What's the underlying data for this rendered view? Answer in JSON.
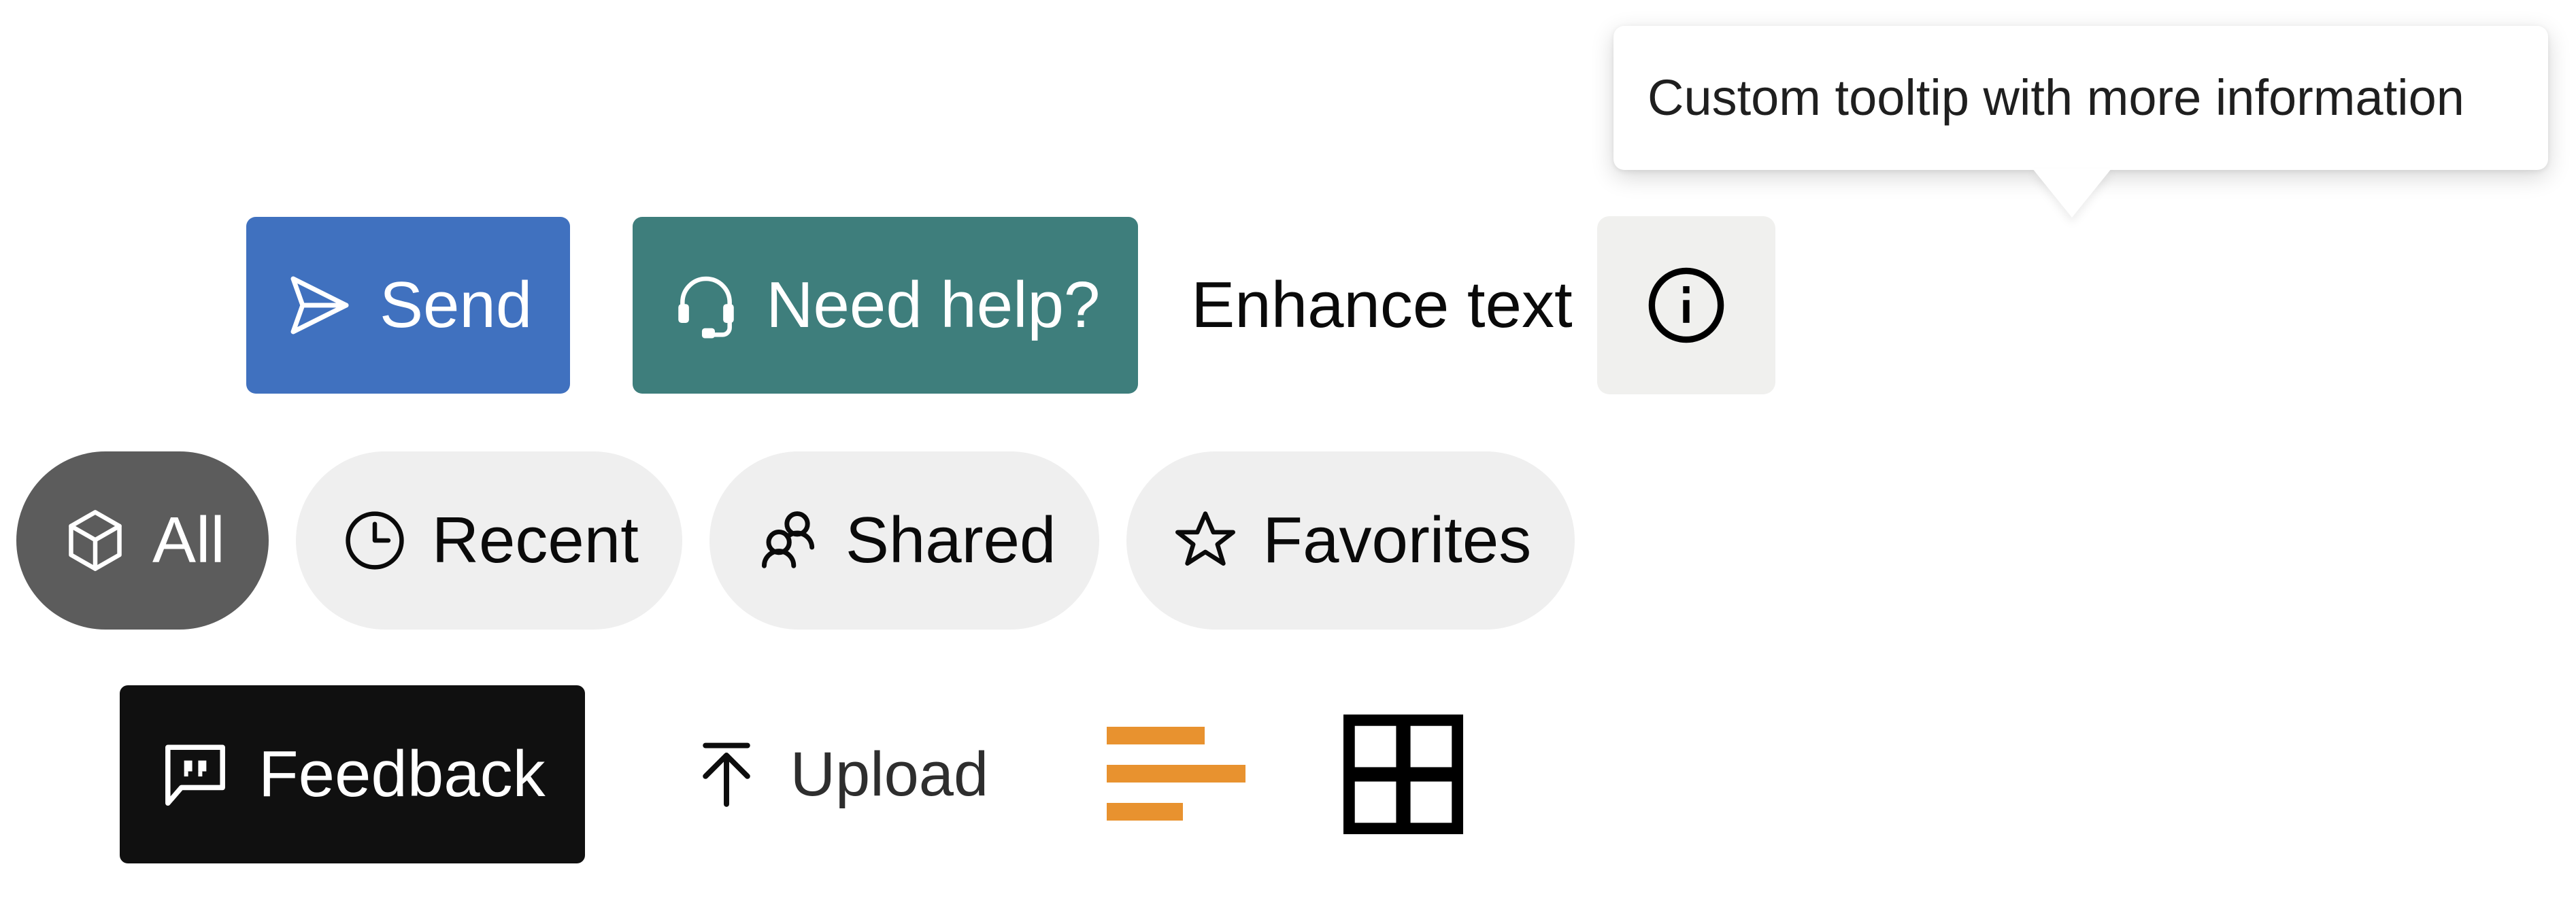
{
  "tooltip": {
    "text": "Custom tooltip with more information",
    "background": "#ffffff",
    "text_color": "#1f1f1f"
  },
  "actions": {
    "send": {
      "label": "Send",
      "icon": "send-icon",
      "background": "#4071bf",
      "text_color": "#ffffff"
    },
    "need_help": {
      "label": "Need help?",
      "icon": "headset-icon",
      "background": "#3e7e7c",
      "text_color": "#ffffff"
    },
    "enhance": {
      "label": "Enhance text",
      "text_color": "#0a0a0a"
    },
    "info": {
      "icon": "info-circle-icon",
      "background": "#f0f0ee",
      "icon_color": "#000000"
    }
  },
  "filters": {
    "items": [
      {
        "label": "All",
        "icon": "cube-icon",
        "selected": true,
        "background": "#5c5c5c",
        "text_color": "#ffffff"
      },
      {
        "label": "Recent",
        "icon": "clock-icon",
        "selected": false,
        "background": "#efefef",
        "text_color": "#0a0a0a"
      },
      {
        "label": "Shared",
        "icon": "users-icon",
        "selected": false,
        "background": "#efefef",
        "text_color": "#0a0a0a"
      },
      {
        "label": "Favorites",
        "icon": "star-icon",
        "selected": false,
        "background": "#efefef",
        "text_color": "#0a0a0a"
      }
    ]
  },
  "utility": {
    "feedback": {
      "label": "Feedback",
      "icon": "speech-bubble-quote-icon",
      "background": "#101010",
      "text_color": "#ffffff"
    },
    "upload": {
      "label": "Upload",
      "icon": "upload-arrow-icon",
      "text_color": "#2e2e2e"
    },
    "list_view": {
      "icon": "list-lines-icon",
      "color": "#e8922f"
    },
    "grid_view": {
      "icon": "grid-2x2-icon",
      "color": "#000000"
    }
  }
}
